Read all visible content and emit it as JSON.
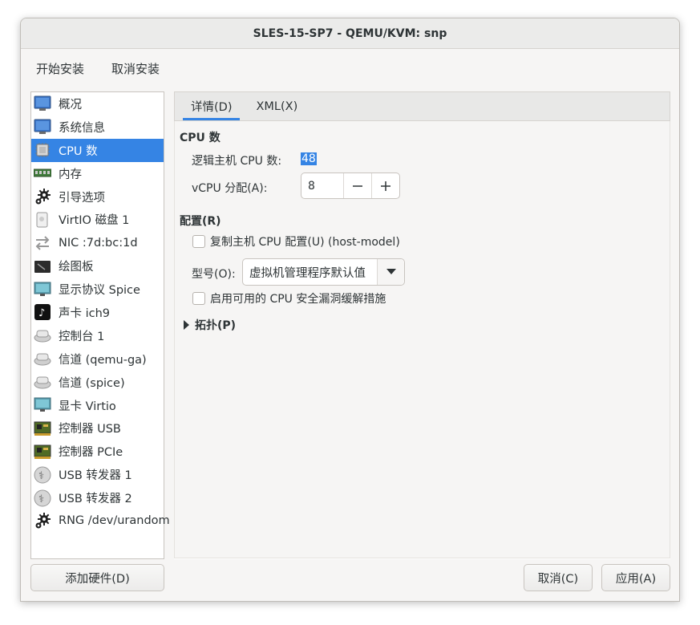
{
  "window": {
    "title": "SLES-15-SP7 - QEMU/KVM: snp"
  },
  "menu": [
    "开始安装",
    "取消安装"
  ],
  "sidebar": {
    "items": [
      {
        "label": "概况",
        "icon": "monitor-icon"
      },
      {
        "label": "系统信息",
        "icon": "monitor-icon"
      },
      {
        "label": "CPU 数",
        "icon": "cpu-chip-icon"
      },
      {
        "label": "内存",
        "icon": "memory-icon"
      },
      {
        "label": "引导选项",
        "icon": "gear-icon"
      },
      {
        "label": "VirtIO 磁盘 1",
        "icon": "disk-icon"
      },
      {
        "label": "NIC :7d:bc:1d",
        "icon": "network-arrows-icon"
      },
      {
        "label": "绘图板",
        "icon": "tablet-icon"
      },
      {
        "label": "显示协议 Spice",
        "icon": "display-icon"
      },
      {
        "label": "声卡 ich9",
        "icon": "sound-card-icon"
      },
      {
        "label": "控制台 1",
        "icon": "serial-device-icon"
      },
      {
        "label": "信道 (qemu-ga)",
        "icon": "serial-device-icon"
      },
      {
        "label": "信道 (spice)",
        "icon": "serial-device-icon"
      },
      {
        "label": "显卡 Virtio",
        "icon": "display-icon"
      },
      {
        "label": "控制器 USB",
        "icon": "controller-card-icon"
      },
      {
        "label": "控制器 PCIe",
        "icon": "controller-card-icon"
      },
      {
        "label": "USB 转发器 1",
        "icon": "usb-redirect-icon"
      },
      {
        "label": "USB 转发器 2",
        "icon": "usb-redirect-icon"
      },
      {
        "label": "RNG /dev/urandom",
        "icon": "gear-icon"
      }
    ],
    "selected_index": 2
  },
  "tabs": [
    "详情(D)",
    "XML(X)"
  ],
  "details": {
    "cpu_section_title": "CPU 数",
    "host_cpu_label": "逻辑主机 CPU 数:",
    "host_cpu_value": "48",
    "vcpu_label": "vCPU 分配(A):",
    "vcpu_value": "8",
    "config_section_title": "配置(R)",
    "copy_host_label": "复制主机 CPU 配置(U) (host-model)",
    "model_label": "型号(O):",
    "model_value": "虚拟机管理程序默认值",
    "mitigation_label": "启用可用的 CPU 安全漏洞缓解措施",
    "topology_label": "拓扑(P)"
  },
  "buttons": {
    "add_hardware": "添加硬件(D)",
    "cancel": "取消(C)",
    "apply": "应用(A)"
  },
  "colors": {
    "accent": "#3584e4",
    "window_bg": "#f6f5f4"
  }
}
